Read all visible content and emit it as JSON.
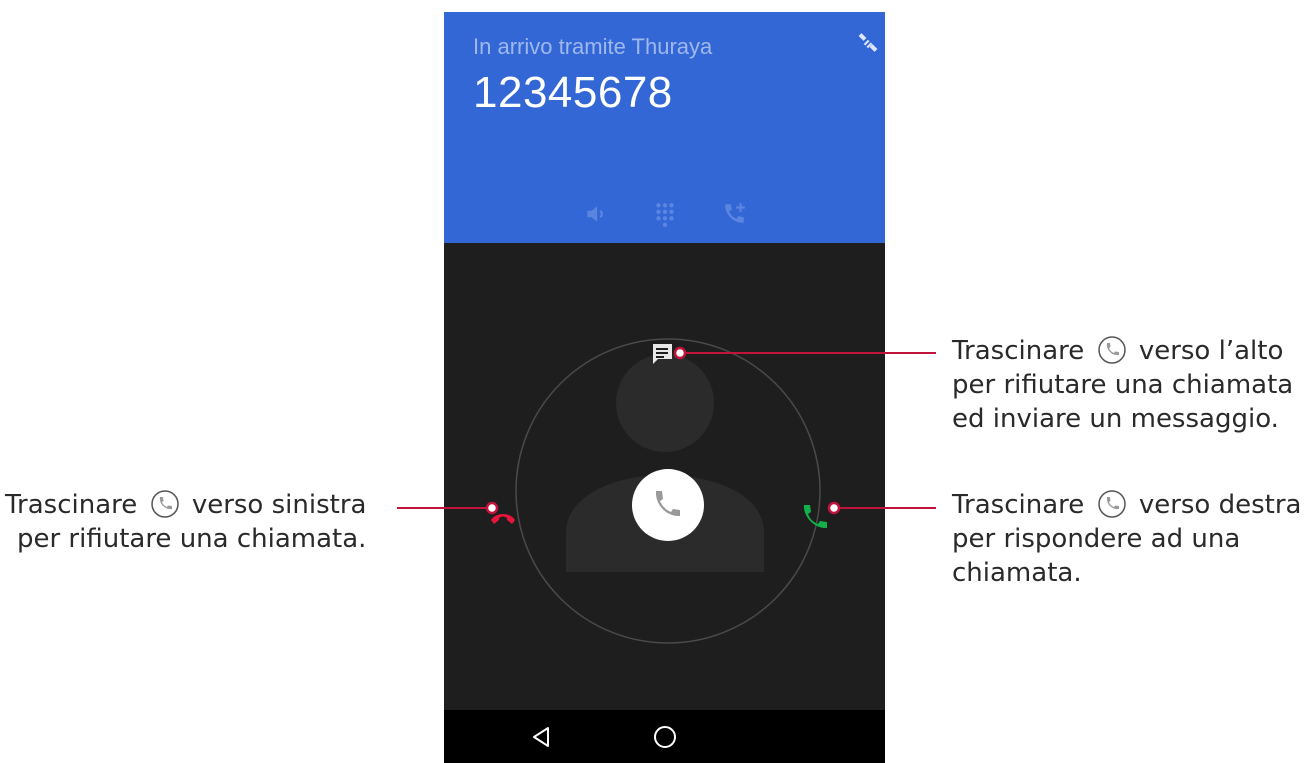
{
  "call": {
    "incoming_label": "In arrivo tramite Thuraya",
    "number": "12345678"
  },
  "header_actions": [
    "speaker-icon",
    "dialpad-icon",
    "add-call-icon"
  ],
  "callouts": {
    "top": {
      "pre": "Trascinare",
      "post": "verso l’alto",
      "line2": "per rifiutare una chiamata",
      "line3": "ed inviare un messaggio."
    },
    "left": {
      "pre": "Trascinare",
      "post": "verso sinistra",
      "line2": "per rifiutare una chiamata."
    },
    "right": {
      "pre": "Trascinare",
      "post": "verso destra",
      "line2": "per rispondere ad una",
      "line3": "chiamata."
    }
  },
  "colors": {
    "header": "#3367d6",
    "background": "#1e1e1e",
    "reject": "#e8143c",
    "answer": "#12b14a",
    "pointer": "#c0143c"
  }
}
